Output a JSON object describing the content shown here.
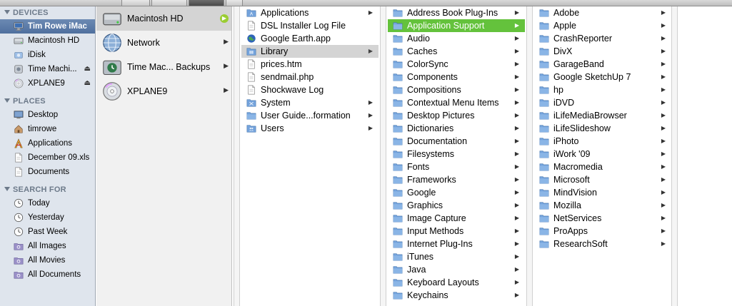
{
  "sidebar": {
    "sections": [
      {
        "title": "DEVICES",
        "items": [
          {
            "label": "Tim Rowe iMac",
            "icon": "imac-icon",
            "selected": true,
            "eject": false
          },
          {
            "label": "Macintosh HD",
            "icon": "hard-drive-icon",
            "selected": false,
            "eject": false
          },
          {
            "label": "iDisk",
            "icon": "idisk-icon",
            "selected": false,
            "eject": false
          },
          {
            "label": "Time Machi...",
            "icon": "external-drive-icon",
            "selected": false,
            "eject": true
          },
          {
            "label": "XPLANE9",
            "icon": "disc-icon",
            "selected": false,
            "eject": true
          }
        ]
      },
      {
        "title": "PLACES",
        "items": [
          {
            "label": "Desktop",
            "icon": "desktop-icon"
          },
          {
            "label": "timrowe",
            "icon": "home-icon"
          },
          {
            "label": "Applications",
            "icon": "applications-icon"
          },
          {
            "label": "December 09.xls",
            "icon": "document-icon"
          },
          {
            "label": "Documents",
            "icon": "document-icon"
          }
        ]
      },
      {
        "title": "SEARCH FOR",
        "items": [
          {
            "label": "Today",
            "icon": "clock-icon"
          },
          {
            "label": "Yesterday",
            "icon": "clock-icon"
          },
          {
            "label": "Past Week",
            "icon": "clock-icon"
          },
          {
            "label": "All Images",
            "icon": "smart-folder-icon"
          },
          {
            "label": "All Movies",
            "icon": "smart-folder-icon"
          },
          {
            "label": "All Documents",
            "icon": "smart-folder-icon"
          }
        ]
      }
    ],
    "eject_glyph": "⏏"
  },
  "column1": {
    "items": [
      {
        "label": "Macintosh HD",
        "icon": "hard-drive-icon",
        "selected": true
      },
      {
        "label": "Network",
        "icon": "network-globe-icon",
        "selected": false
      },
      {
        "label": "Time Mac... Backups",
        "icon": "time-machine-icon",
        "selected": false
      },
      {
        "label": "XPLANE9",
        "icon": "disc-icon",
        "selected": false
      }
    ]
  },
  "column2": {
    "items": [
      {
        "label": "Applications",
        "icon": "applications-folder-icon",
        "arrow": true
      },
      {
        "label": "DSL Installer Log File",
        "icon": "document-icon",
        "arrow": false
      },
      {
        "label": "Google Earth.app",
        "icon": "google-earth-icon",
        "arrow": false
      },
      {
        "label": "Library",
        "icon": "library-folder-icon",
        "arrow": true,
        "selected": "gray"
      },
      {
        "label": "prices.htm",
        "icon": "document-icon",
        "arrow": false
      },
      {
        "label": "sendmail.php",
        "icon": "document-icon",
        "arrow": false
      },
      {
        "label": "Shockwave Log",
        "icon": "document-icon",
        "arrow": false
      },
      {
        "label": "System",
        "icon": "system-folder-icon",
        "arrow": true
      },
      {
        "label": "User Guide...formation",
        "icon": "folder-icon",
        "arrow": true
      },
      {
        "label": "Users",
        "icon": "users-folder-icon",
        "arrow": true
      }
    ]
  },
  "column3": {
    "items": [
      {
        "label": "Address Book Plug-Ins"
      },
      {
        "label": "Application Support",
        "selected": "green"
      },
      {
        "label": "Audio"
      },
      {
        "label": "Caches"
      },
      {
        "label": "ColorSync"
      },
      {
        "label": "Components"
      },
      {
        "label": "Compositions"
      },
      {
        "label": "Contextual Menu Items"
      },
      {
        "label": "Desktop Pictures"
      },
      {
        "label": "Dictionaries"
      },
      {
        "label": "Documentation"
      },
      {
        "label": "Filesystems"
      },
      {
        "label": "Fonts"
      },
      {
        "label": "Frameworks"
      },
      {
        "label": "Google"
      },
      {
        "label": "Graphics"
      },
      {
        "label": "Image Capture"
      },
      {
        "label": "Input Methods"
      },
      {
        "label": "Internet Plug-Ins"
      },
      {
        "label": "iTunes"
      },
      {
        "label": "Java"
      },
      {
        "label": "Keyboard Layouts"
      },
      {
        "label": "Keychains"
      }
    ]
  },
  "column4": {
    "items": [
      {
        "label": "Adobe"
      },
      {
        "label": "Apple"
      },
      {
        "label": "CrashReporter"
      },
      {
        "label": "DivX"
      },
      {
        "label": "GarageBand"
      },
      {
        "label": "Google SketchUp 7"
      },
      {
        "label": "hp"
      },
      {
        "label": "iDVD"
      },
      {
        "label": "iLifeMediaBrowser"
      },
      {
        "label": "iLifeSlideshow"
      },
      {
        "label": "iPhoto"
      },
      {
        "label": "iWork '09"
      },
      {
        "label": "Macromedia"
      },
      {
        "label": "Microsoft"
      },
      {
        "label": "MindVision"
      },
      {
        "label": "Mozilla"
      },
      {
        "label": "NetServices"
      },
      {
        "label": "ProApps"
      },
      {
        "label": "ResearchSoft"
      }
    ]
  },
  "arrow_glyph": "▶",
  "colors": {
    "selection_green": "#64c23c",
    "sidebar_bg": "#dfe5ed",
    "sidebar_selected": "#5a79a7",
    "folder_blue": "#6f9fd8"
  }
}
